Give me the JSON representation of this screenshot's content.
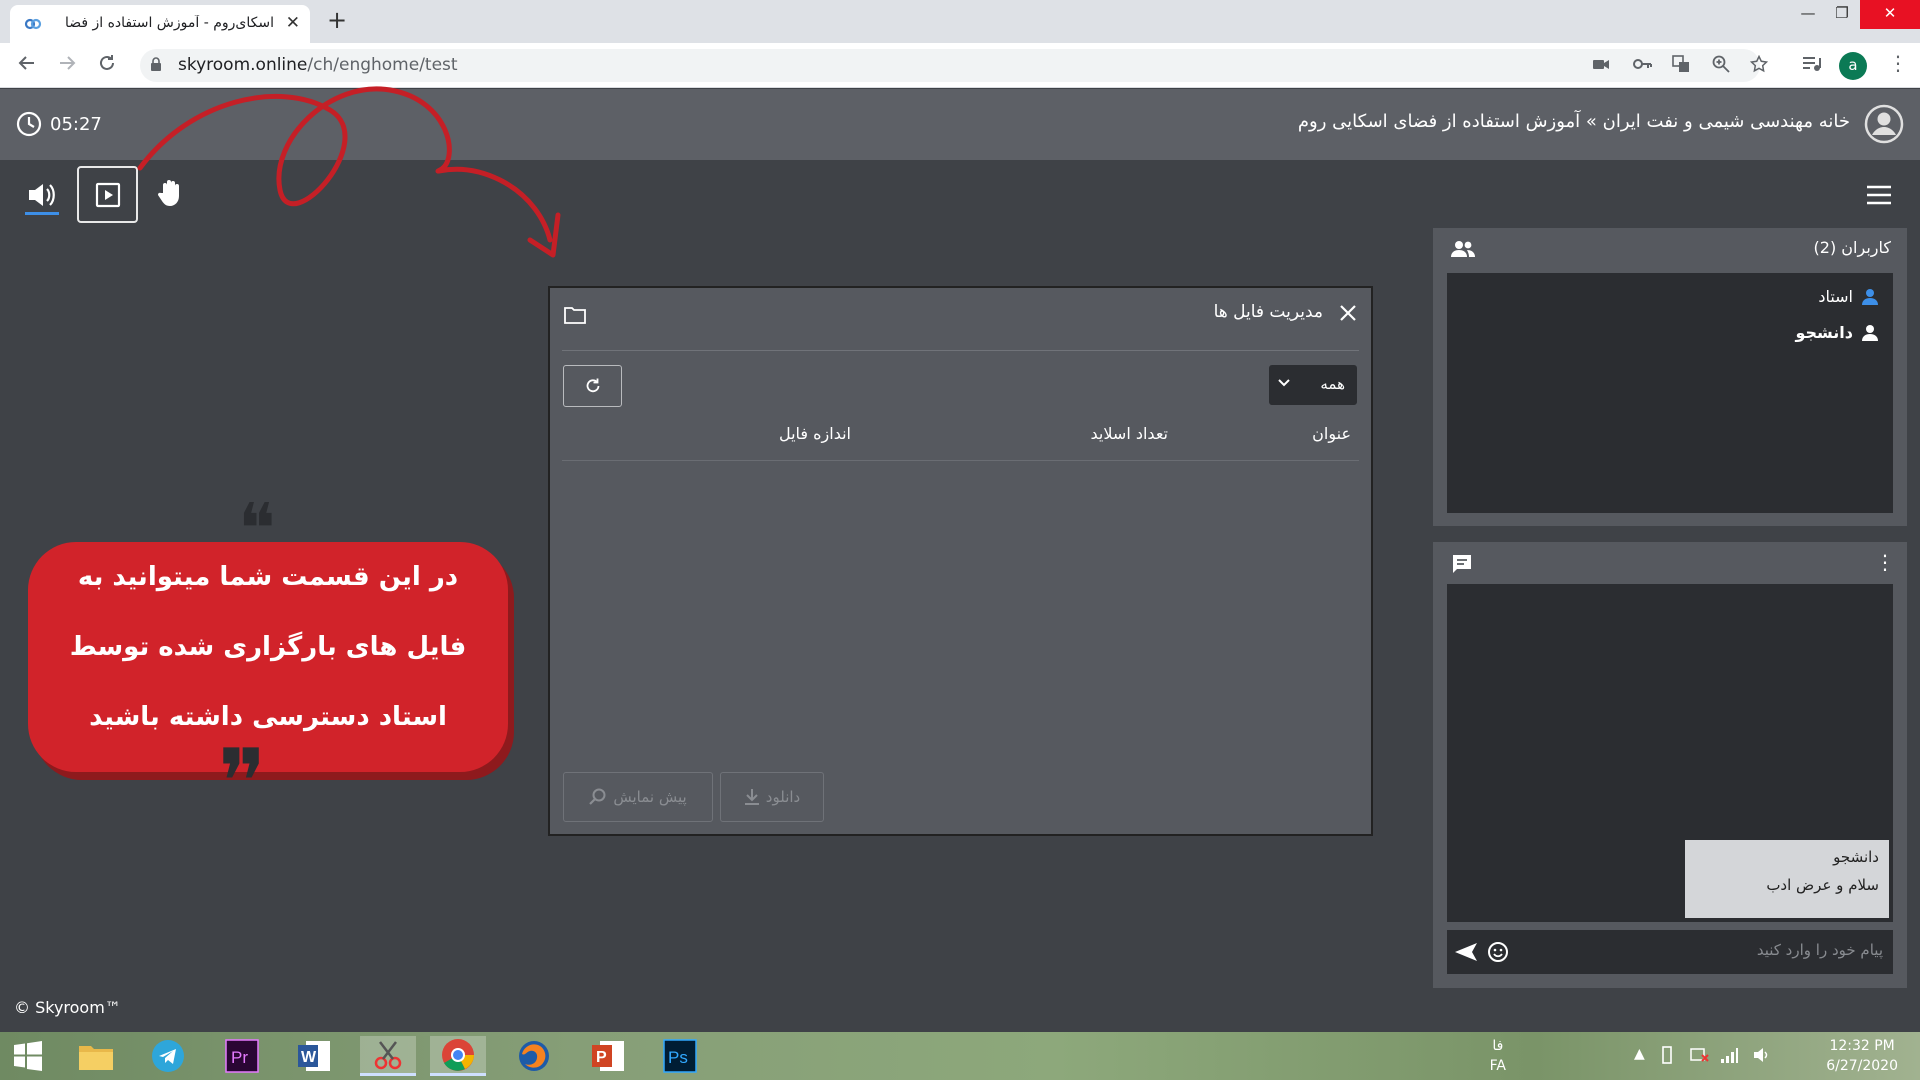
{
  "browser": {
    "tab_title": "اسکای‌روم - آموزش استفاده از فضا",
    "url_host": "skyroom.online",
    "url_path": "/ch/enghome/test",
    "profile_initial": "a"
  },
  "header": {
    "timer": "05:27",
    "breadcrumb": "خانه مهندسی شیمی و نفت ایران » آموزش استفاده از فضای اسکایی روم"
  },
  "users_panel": {
    "title": "کاربران (2)",
    "users": [
      {
        "name": "استاد",
        "role_color": "#3d8fe8"
      },
      {
        "name": "دانشجو",
        "role_color": "#ffffff"
      }
    ]
  },
  "chat": {
    "messages": [
      {
        "sender": "دانشجو",
        "text": "سلام و عرض ادب"
      }
    ],
    "input_placeholder": "پیام خود را وارد کنید"
  },
  "file_manager": {
    "title": "مدیریت فایل ها",
    "filter_value": "همه",
    "columns": [
      "عنوان",
      "تعداد اسلاید",
      "اندازه فایل"
    ],
    "download_label": "دانلود",
    "preview_label": "پیش نمایش"
  },
  "annotation": {
    "lines": [
      "در این قسمت شما میتوانید به",
      "فایل های بارگزاری شده توسط",
      "استاد دسترسی داشته باشید"
    ]
  },
  "footer": {
    "copyright": "© Skyroom™"
  },
  "taskbar": {
    "lang_top": "فا",
    "lang_bottom": "FA",
    "time": "12:32 PM",
    "date": "6/27/2020"
  },
  "colors": {
    "accent": "#3d8fe8",
    "annotation": "#d1232a",
    "panel": "#56595f",
    "dark": "#2b2d31"
  }
}
